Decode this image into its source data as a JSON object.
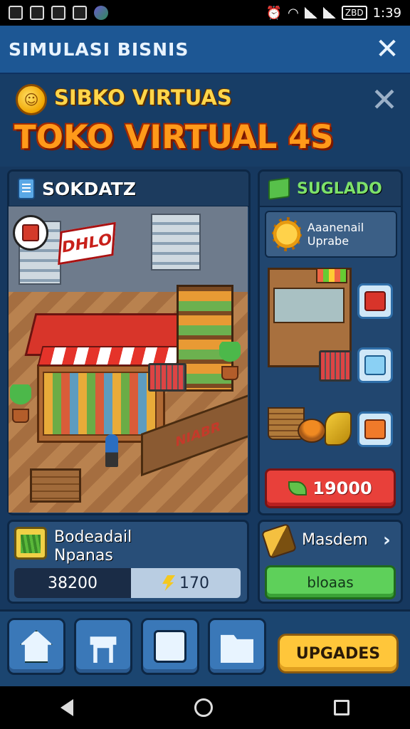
{
  "status_bar": {
    "time": "1:39",
    "battery": "ZBD"
  },
  "app_bar": {
    "title": "SIMULASI BISNIS",
    "close_glyph": "✕"
  },
  "header": {
    "subtitle": "SIBKO VIRTUAS",
    "title": "TOKO VIRTUAL 4S",
    "close_glyph": "✕"
  },
  "store_panel": {
    "label": "SOKDATZ",
    "sign_text": "DHLO",
    "fence_text": "NIABR"
  },
  "shop_panel": {
    "label": "SUGLADO",
    "upgrade_card_text": "Aaanenail Uprabe",
    "price": "19000"
  },
  "info_card": {
    "line1": "Bodeadail",
    "line2": "Npanas",
    "stat_left": "38200",
    "stat_right": "170"
  },
  "task_card": {
    "label": "Masdem",
    "chevron": "›",
    "button_label": "bloaas"
  },
  "bottom_nav": {
    "upgrade_label": "UPGADES",
    "items": [
      "home",
      "table",
      "device",
      "folder"
    ]
  },
  "colors": {
    "background": "#16385f",
    "app_bar": "#1d5794",
    "title_orange": "#ff9a1a",
    "subtitle_gold": "#ffd64a",
    "price_red": "#e8403a",
    "action_green": "#5ed05a",
    "upgrade_yellow": "#ffc63a"
  }
}
